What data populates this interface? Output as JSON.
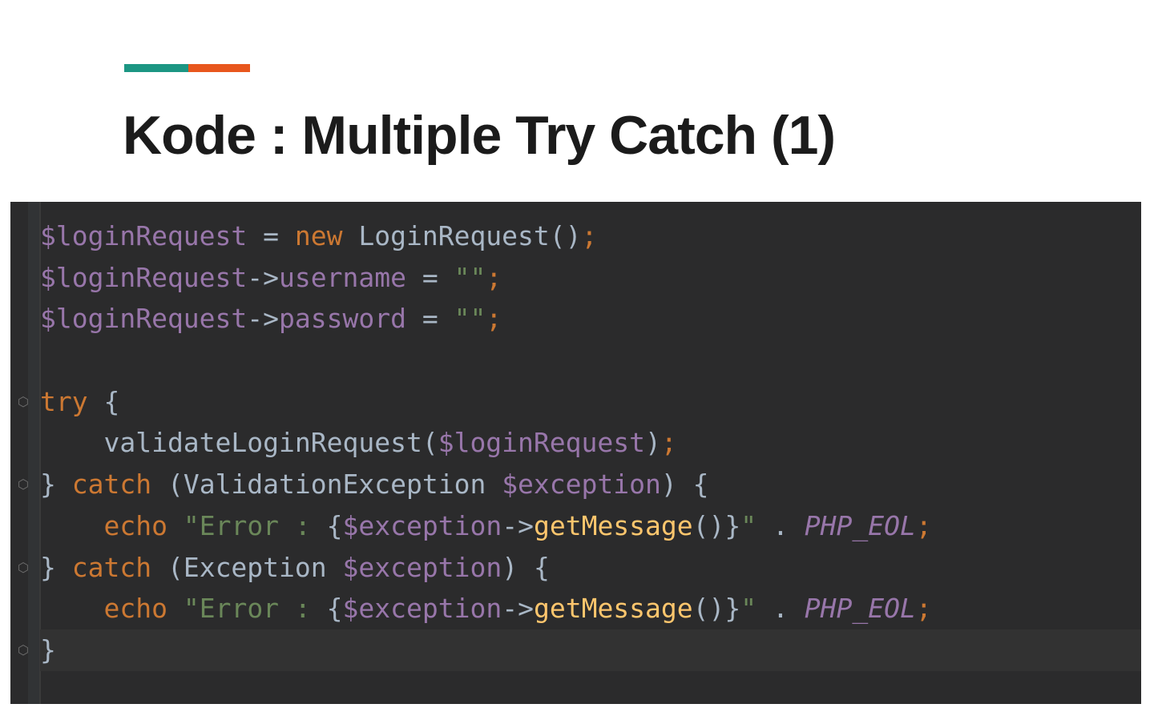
{
  "slide": {
    "accent_colors": [
      "#1c9683",
      "#e8571d"
    ],
    "title": "Kode : Multiple Try Catch (1)"
  },
  "code": {
    "lines": [
      [
        {
          "t": "$loginRequest",
          "c": "var"
        },
        {
          "t": " = ",
          "c": "plain"
        },
        {
          "t": "new",
          "c": "kw"
        },
        {
          "t": " LoginRequest()",
          "c": "plain"
        },
        {
          "t": ";",
          "c": "kw"
        }
      ],
      [
        {
          "t": "$loginRequest",
          "c": "var"
        },
        {
          "t": "->",
          "c": "plain"
        },
        {
          "t": "username",
          "c": "var"
        },
        {
          "t": " = ",
          "c": "plain"
        },
        {
          "t": "\"\"",
          "c": "str"
        },
        {
          "t": ";",
          "c": "kw"
        }
      ],
      [
        {
          "t": "$loginRequest",
          "c": "var"
        },
        {
          "t": "->",
          "c": "plain"
        },
        {
          "t": "password",
          "c": "var"
        },
        {
          "t": " = ",
          "c": "plain"
        },
        {
          "t": "\"\"",
          "c": "str"
        },
        {
          "t": ";",
          "c": "kw"
        }
      ],
      [],
      [
        {
          "t": "try",
          "c": "kw"
        },
        {
          "t": " {",
          "c": "plain"
        }
      ],
      [
        {
          "t": "    validateLoginRequest(",
          "c": "plain"
        },
        {
          "t": "$loginRequest",
          "c": "var"
        },
        {
          "t": ")",
          "c": "plain"
        },
        {
          "t": ";",
          "c": "kw"
        }
      ],
      [
        {
          "t": "} ",
          "c": "plain"
        },
        {
          "t": "catch",
          "c": "kw"
        },
        {
          "t": " (ValidationException ",
          "c": "plain"
        },
        {
          "t": "$exception",
          "c": "var"
        },
        {
          "t": ") {",
          "c": "plain"
        }
      ],
      [
        {
          "t": "    ",
          "c": "plain"
        },
        {
          "t": "echo",
          "c": "kw"
        },
        {
          "t": " ",
          "c": "plain"
        },
        {
          "t": "\"Error : ",
          "c": "str"
        },
        {
          "t": "{",
          "c": "plain"
        },
        {
          "t": "$exception",
          "c": "var"
        },
        {
          "t": "->",
          "c": "plain"
        },
        {
          "t": "getMessage",
          "c": "fn"
        },
        {
          "t": "()}",
          "c": "plain"
        },
        {
          "t": "\"",
          "c": "str"
        },
        {
          "t": " . ",
          "c": "plain"
        },
        {
          "t": "PHP_EOL",
          "c": "const"
        },
        {
          "t": ";",
          "c": "kw"
        }
      ],
      [
        {
          "t": "} ",
          "c": "plain"
        },
        {
          "t": "catch",
          "c": "kw"
        },
        {
          "t": " (Exception ",
          "c": "plain"
        },
        {
          "t": "$exception",
          "c": "var"
        },
        {
          "t": ") {",
          "c": "plain"
        }
      ],
      [
        {
          "t": "    ",
          "c": "plain"
        },
        {
          "t": "echo",
          "c": "kw"
        },
        {
          "t": " ",
          "c": "plain"
        },
        {
          "t": "\"Error : ",
          "c": "str"
        },
        {
          "t": "{",
          "c": "plain"
        },
        {
          "t": "$exception",
          "c": "var"
        },
        {
          "t": "->",
          "c": "plain"
        },
        {
          "t": "getMessage",
          "c": "fn"
        },
        {
          "t": "()}",
          "c": "plain"
        },
        {
          "t": "\"",
          "c": "str"
        },
        {
          "t": " . ",
          "c": "plain"
        },
        {
          "t": "PHP_EOL",
          "c": "const"
        },
        {
          "t": ";",
          "c": "kw"
        }
      ],
      [
        {
          "t": "}",
          "c": "plain"
        }
      ]
    ],
    "fold_markers": [
      4,
      6,
      8,
      10
    ],
    "current_line": 10
  }
}
